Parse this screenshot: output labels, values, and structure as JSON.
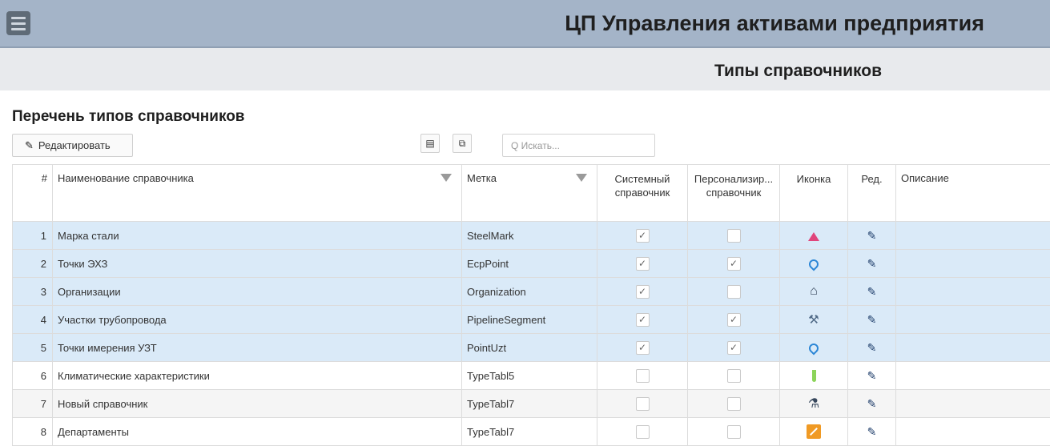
{
  "header": {
    "app_title": "ЦП Управления активами предприятия",
    "page_title": "Типы справочников"
  },
  "section": {
    "title": "Перечень типов справочников"
  },
  "toolbar": {
    "edit_label": "Редактировать",
    "search_placeholder": "Q Искать..."
  },
  "table": {
    "columns": {
      "num": "#",
      "name": "Наименование справочника",
      "tag": "Метка",
      "system": "Системный справочник",
      "personal": "Персонализир... справочник",
      "icon": "Иконка",
      "edit": "Ред.",
      "desc": "Описание"
    },
    "rows": [
      {
        "num": "1",
        "name": "Марка стали",
        "tag": "SteelMark",
        "system": true,
        "personal": false,
        "icon": "flask-icon",
        "selected": true
      },
      {
        "num": "2",
        "name": "Точки ЭХЗ",
        "tag": "EcpPoint",
        "system": true,
        "personal": true,
        "icon": "map-pin-icon",
        "selected": true
      },
      {
        "num": "3",
        "name": "Организации",
        "tag": "Organization",
        "system": true,
        "personal": false,
        "icon": "house-icon",
        "selected": true
      },
      {
        "num": "4",
        "name": "Участки трубопровода",
        "tag": "PipelineSegment",
        "system": true,
        "personal": true,
        "icon": "tool-icon",
        "selected": true
      },
      {
        "num": "5",
        "name": "Точки имерения УЗТ",
        "tag": "PointUzt",
        "system": true,
        "personal": true,
        "icon": "map-pin-icon",
        "selected": true
      },
      {
        "num": "6",
        "name": "Климатические характеристики",
        "tag": "TypeTabl5",
        "system": false,
        "personal": false,
        "icon": "test-tube-icon",
        "selected": false
      },
      {
        "num": "7",
        "name": "Новый справочник",
        "tag": "TypeTabl7",
        "system": false,
        "personal": false,
        "icon": "microscope-icon",
        "selected": false
      },
      {
        "num": "8",
        "name": "Департаменты",
        "tag": "TypeTabl7",
        "system": false,
        "personal": false,
        "icon": "ruler-icon",
        "selected": false
      }
    ]
  },
  "colors": {
    "topbar": "#a4b4c8",
    "subbar": "#e8eaed",
    "selected_row": "#daeaf8",
    "pin": "#2b86d6"
  }
}
